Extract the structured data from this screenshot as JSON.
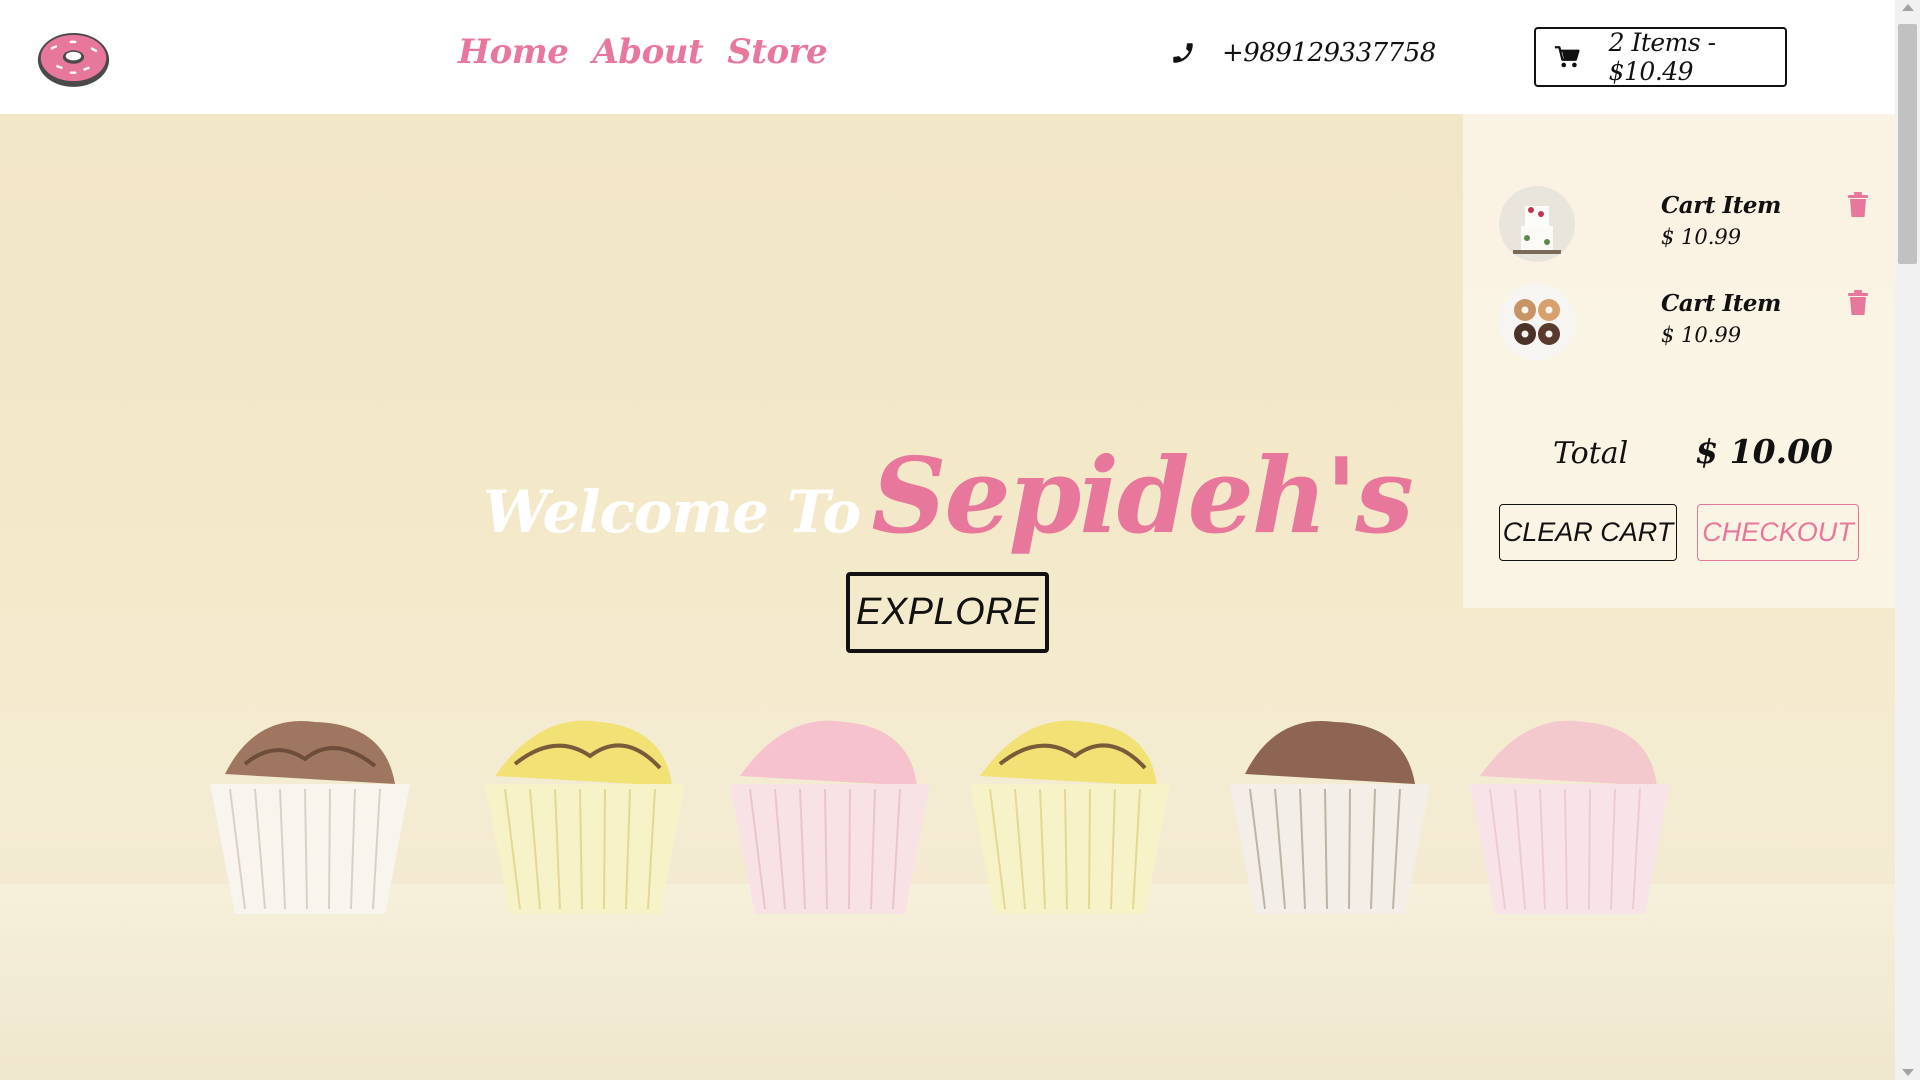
{
  "navbar": {
    "links": [
      {
        "label": "Home"
      },
      {
        "label": "About"
      },
      {
        "label": "Store"
      }
    ],
    "phone": "+989129337758",
    "cart_summary": "2 Items - $10.49"
  },
  "hero": {
    "welcome": "Welcome To",
    "brand": "Sepideh's",
    "explore_label": "EXPLORE"
  },
  "cart": {
    "items": [
      {
        "title": "Cart Item",
        "price": "$ 10.99",
        "thumb": "cake"
      },
      {
        "title": "Cart Item",
        "price": "$ 10.99",
        "thumb": "donuts"
      }
    ],
    "total_label": "Total",
    "total_value": "$ 10.00",
    "clear_label": "CLEAR CART",
    "checkout_label": "CHECKOUT"
  },
  "colors": {
    "accent": "#e8779c",
    "text": "#111111",
    "hero_bg": "#f3e9c9"
  }
}
